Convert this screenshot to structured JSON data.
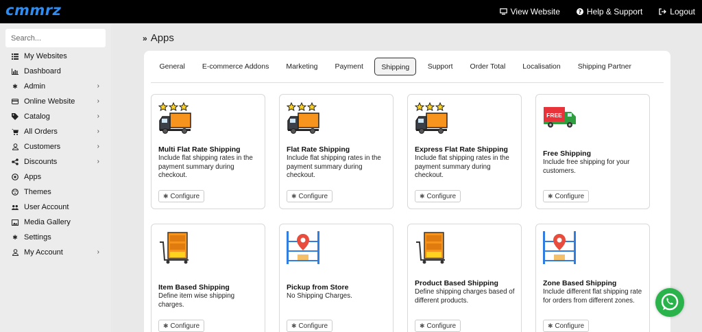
{
  "header": {
    "logo": "cmmrz",
    "links": [
      {
        "label": "View Website",
        "icon": "monitor-icon"
      },
      {
        "label": "Help & Support",
        "icon": "question-circle-icon"
      },
      {
        "label": "Logout",
        "icon": "logout-icon"
      }
    ]
  },
  "sidebar": {
    "search_placeholder": "Search...",
    "items": [
      {
        "label": "My Websites",
        "icon": "list-icon",
        "has_children": false
      },
      {
        "label": "Dashboard",
        "icon": "chart-icon",
        "has_children": false
      },
      {
        "label": "Admin",
        "icon": "gear-icon",
        "has_children": true
      },
      {
        "label": "Online Website",
        "icon": "card-icon",
        "has_children": true
      },
      {
        "label": "Catalog",
        "icon": "tags-icon",
        "has_children": true
      },
      {
        "label": "All Orders",
        "icon": "cart-icon",
        "has_children": true
      },
      {
        "label": "Customers",
        "icon": "user-icon",
        "has_children": true
      },
      {
        "label": "Discounts",
        "icon": "share-icon",
        "has_children": true
      },
      {
        "label": "Apps",
        "icon": "apps-icon",
        "has_children": false
      },
      {
        "label": "Themes",
        "icon": "themes-icon",
        "has_children": false
      },
      {
        "label": "User Account",
        "icon": "users-icon",
        "has_children": false
      },
      {
        "label": "Media Gallery",
        "icon": "image-icon",
        "has_children": false
      },
      {
        "label": "Settings",
        "icon": "settings-icon",
        "has_children": false
      },
      {
        "label": "My Account",
        "icon": "account-icon",
        "has_children": true
      }
    ]
  },
  "breadcrumb": "Apps",
  "tabs": [
    {
      "label": "General",
      "active": false
    },
    {
      "label": "E-commerce Addons",
      "active": false
    },
    {
      "label": "Marketing",
      "active": false
    },
    {
      "label": "Payment",
      "active": false
    },
    {
      "label": "Shipping",
      "active": true
    },
    {
      "label": "Support",
      "active": false
    },
    {
      "label": "Order Total",
      "active": false
    },
    {
      "label": "Localisation",
      "active": false
    },
    {
      "label": "Shipping Partner",
      "active": false
    }
  ],
  "configure_label": "Configure",
  "cards": [
    {
      "title": "Multi Flat Rate Shipping",
      "desc": "Include flat shipping rates in the payment summary during checkout.",
      "icon": "truck-three-stars-icon"
    },
    {
      "title": "Flat Rate Shipping",
      "desc": "Include flat shipping rates in the payment summary during checkout.",
      "icon": "truck-three-stars-icon"
    },
    {
      "title": "Express Flat Rate Shipping",
      "desc": "Include flat shipping rates in the payment summary during checkout.",
      "icon": "truck-three-stars-icon"
    },
    {
      "title": "Free Shipping",
      "desc": "Include free shipping for your customers.",
      "icon": "free-delivery-truck-icon",
      "badge": "FREE"
    },
    {
      "title": "Item Based Shipping",
      "desc": "Define item wise shipping charges.",
      "icon": "shelf-trolley-icon"
    },
    {
      "title": "Pickup from Store",
      "desc": "No Shipping Charges.",
      "icon": "warehouse-pin-icon"
    },
    {
      "title": "Product Based Shipping",
      "desc": "Define shipping charges based of different products.",
      "icon": "shelf-trolley-icon"
    },
    {
      "title": "Zone Based Shipping",
      "desc": "Include different flat shipping rate for orders from different zones.",
      "icon": "warehouse-pin-icon"
    }
  ],
  "colors": {
    "topbar": "#000000",
    "logo": "#2f8cf0",
    "truck_orange": "#f7941d",
    "truck_green": "#2e9e3e",
    "pin_red": "#e84c3d",
    "whatsapp": "#29b34a"
  }
}
